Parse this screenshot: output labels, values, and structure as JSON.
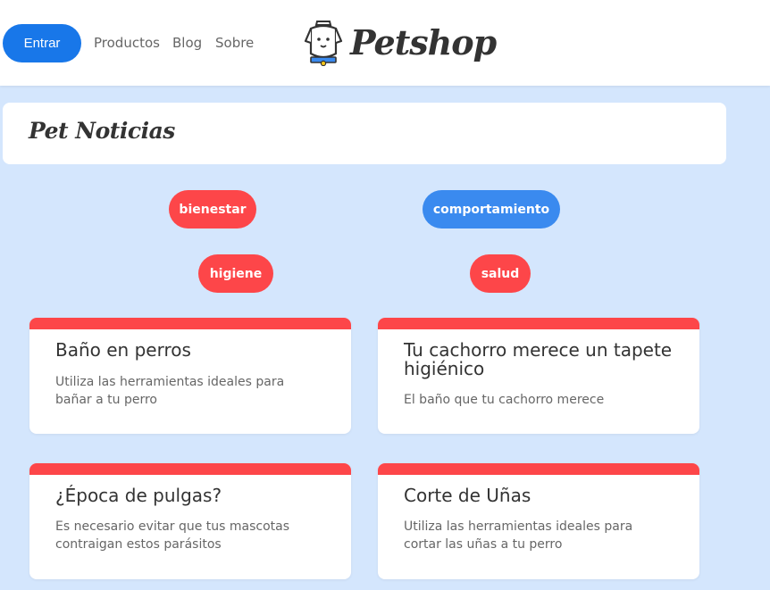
{
  "header": {
    "login_label": "Entrar",
    "nav": [
      "Productos",
      "Blog",
      "Sobre"
    ],
    "logo_text": "Petshop"
  },
  "page_title": "Pet Noticias",
  "categories": [
    {
      "label": "bienestar",
      "color": "#fd4649"
    },
    {
      "label": "comportamiento",
      "color": "#3a8aef"
    },
    {
      "label": "higiene",
      "color": "#fd4649"
    },
    {
      "label": "salud",
      "color": "#fd4649"
    }
  ],
  "posts": [
    {
      "title": "Baño en perros",
      "description": "Utiliza las herramientas ideales para bañar a tu perro"
    },
    {
      "title": "Tu cachorro merece un tapete higiénico",
      "description": "El baño que tu cachorro merece"
    },
    {
      "title": "¿Época de pulgas?",
      "description": "Es necesario evitar que tus mascotas contraigan estos parásitos"
    },
    {
      "title": "Corte de Uñas",
      "description": "Utiliza las herramientas ideales para cortar las uñas a tu perro"
    }
  ],
  "colors": {
    "accent_red": "#fd4649",
    "accent_blue": "#1877e9",
    "background": "#d4e6fd"
  }
}
